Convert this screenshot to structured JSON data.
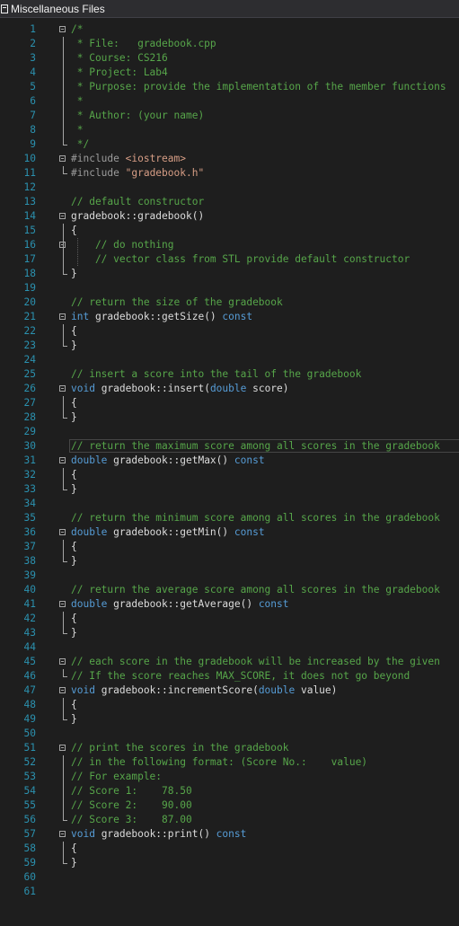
{
  "window": {
    "title": "Miscellaneous Files"
  },
  "editor": {
    "lines": [
      [
        {
          "c": "c",
          "t": "/*"
        }
      ],
      [
        {
          "c": "c",
          "t": " * File:   gradebook.cpp"
        }
      ],
      [
        {
          "c": "c",
          "t": " * Course: CS216"
        }
      ],
      [
        {
          "c": "c",
          "t": " * Project: Lab4"
        }
      ],
      [
        {
          "c": "c",
          "t": " * Purpose: provide the implementation of the member functions"
        }
      ],
      [
        {
          "c": "c",
          "t": " *"
        }
      ],
      [
        {
          "c": "c",
          "t": " * Author: (your name)"
        }
      ],
      [
        {
          "c": "c",
          "t": " *"
        }
      ],
      [
        {
          "c": "c",
          "t": " */"
        }
      ],
      [
        {
          "c": "p",
          "t": "#include "
        },
        {
          "c": "s",
          "t": "<iostream>"
        }
      ],
      [
        {
          "c": "p",
          "t": "#include "
        },
        {
          "c": "s",
          "t": "\"gradebook.h\""
        }
      ],
      [],
      [
        {
          "c": "c",
          "t": "// default constructor"
        }
      ],
      [
        {
          "c": "t",
          "t": "gradebook::gradebook()"
        }
      ],
      [
        {
          "c": "t",
          "t": "{"
        }
      ],
      [
        {
          "c": "c",
          "t": "    // do nothing"
        }
      ],
      [
        {
          "c": "c",
          "t": "    // vector class from STL provide default constructor"
        }
      ],
      [
        {
          "c": "t",
          "t": "}"
        }
      ],
      [],
      [
        {
          "c": "c",
          "t": "// return the size of the gradebook"
        }
      ],
      [
        {
          "c": "k",
          "t": "int "
        },
        {
          "c": "t",
          "t": "gradebook::getSize() "
        },
        {
          "c": "k",
          "t": "const"
        }
      ],
      [
        {
          "c": "t",
          "t": "{"
        }
      ],
      [
        {
          "c": "t",
          "t": "}"
        }
      ],
      [],
      [
        {
          "c": "c",
          "t": "// insert a score into the tail of the gradebook"
        }
      ],
      [
        {
          "c": "k",
          "t": "void "
        },
        {
          "c": "t",
          "t": "gradebook::insert("
        },
        {
          "c": "k",
          "t": "double "
        },
        {
          "c": "t",
          "t": "score)"
        }
      ],
      [
        {
          "c": "t",
          "t": "{"
        }
      ],
      [
        {
          "c": "t",
          "t": "}"
        }
      ],
      [],
      [
        {
          "c": "c",
          "t": "// return the maximum score among all scores in the gradebook"
        }
      ],
      [
        {
          "c": "k",
          "t": "double "
        },
        {
          "c": "t",
          "t": "gradebook::getMax() "
        },
        {
          "c": "k",
          "t": "const"
        }
      ],
      [
        {
          "c": "t",
          "t": "{"
        }
      ],
      [
        {
          "c": "t",
          "t": "}"
        }
      ],
      [],
      [
        {
          "c": "c",
          "t": "// return the minimum score among all scores in the gradebook"
        }
      ],
      [
        {
          "c": "k",
          "t": "double "
        },
        {
          "c": "t",
          "t": "gradebook::getMin() "
        },
        {
          "c": "k",
          "t": "const"
        }
      ],
      [
        {
          "c": "t",
          "t": "{"
        }
      ],
      [
        {
          "c": "t",
          "t": "}"
        }
      ],
      [],
      [
        {
          "c": "c",
          "t": "// return the average score among all scores in the gradebook"
        }
      ],
      [
        {
          "c": "k",
          "t": "double "
        },
        {
          "c": "t",
          "t": "gradebook::getAverage() "
        },
        {
          "c": "k",
          "t": "const"
        }
      ],
      [
        {
          "c": "t",
          "t": "{"
        }
      ],
      [
        {
          "c": "t",
          "t": "}"
        }
      ],
      [],
      [
        {
          "c": "c",
          "t": "// each score in the gradebook will be increased by the given"
        }
      ],
      [
        {
          "c": "c",
          "t": "// If the score reaches MAX_SCORE, it does not go beyond"
        }
      ],
      [
        {
          "c": "k",
          "t": "void "
        },
        {
          "c": "t",
          "t": "gradebook::incrementScore("
        },
        {
          "c": "k",
          "t": "double "
        },
        {
          "c": "t",
          "t": "value)"
        }
      ],
      [
        {
          "c": "t",
          "t": "{"
        }
      ],
      [
        {
          "c": "t",
          "t": "}"
        }
      ],
      [],
      [
        {
          "c": "c",
          "t": "// print the scores in the gradebook"
        }
      ],
      [
        {
          "c": "c",
          "t": "// in the following format: (Score No.:    value)"
        }
      ],
      [
        {
          "c": "c",
          "t": "// For example:"
        }
      ],
      [
        {
          "c": "c",
          "t": "// Score 1:    78.50"
        }
      ],
      [
        {
          "c": "c",
          "t": "// Score 2:    90.00"
        }
      ],
      [
        {
          "c": "c",
          "t": "// Score 3:    87.00"
        }
      ],
      [
        {
          "c": "k",
          "t": "void "
        },
        {
          "c": "t",
          "t": "gradebook::print() "
        },
        {
          "c": "k",
          "t": "const"
        }
      ],
      [
        {
          "c": "t",
          "t": "{"
        }
      ],
      [
        {
          "c": "t",
          "t": "}"
        }
      ],
      [],
      []
    ],
    "line_numbers": [
      "1",
      "2",
      "3",
      "4",
      "5",
      "6",
      "7",
      "8",
      "9",
      "10",
      "11",
      "12",
      "13",
      "14",
      "15",
      "16",
      "17",
      "18",
      "19",
      "20",
      "21",
      "22",
      "23",
      "24",
      "25",
      "26",
      "27",
      "28",
      "29",
      "30",
      "31",
      "32",
      "33",
      "34",
      "35",
      "36",
      "37",
      "38",
      "39",
      "40",
      "41",
      "42",
      "43",
      "44",
      "45",
      "46",
      "47",
      "48",
      "49",
      "50",
      "51",
      "52",
      "53",
      "54",
      "55",
      "56",
      "57",
      "58",
      "59",
      "60",
      "61"
    ]
  },
  "colors": {
    "background": "#1e1e1e",
    "line_number": "#2b91af",
    "comment": "#57a64a",
    "keyword": "#569cd6",
    "preprocessor": "#9b9b9b",
    "string": "#d69d85",
    "text": "#dcdcdc"
  },
  "icons": {
    "file": "file-icon",
    "collapse": "collapse-icon"
  }
}
